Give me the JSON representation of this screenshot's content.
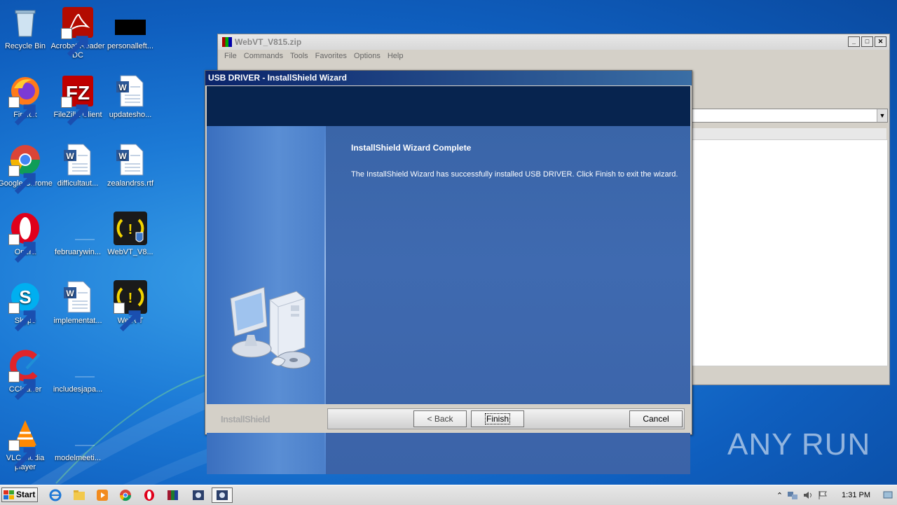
{
  "desktop": {
    "icons": [
      {
        "label": "Recycle Bin"
      },
      {
        "label": "Acrobat Reader DC"
      },
      {
        "label": "personalleft..."
      },
      {
        "label": "Firefox"
      },
      {
        "label": "FileZilla Client"
      },
      {
        "label": "updatesho..."
      },
      {
        "label": "Google Chrome"
      },
      {
        "label": "difficultaut..."
      },
      {
        "label": "zealandrss.rtf"
      },
      {
        "label": "Opera"
      },
      {
        "label": "februarywin..."
      },
      {
        "label": "WebVT_V8..."
      },
      {
        "label": "Skype"
      },
      {
        "label": "implementat..."
      },
      {
        "label": "WebVT"
      },
      {
        "label": "CCleaner"
      },
      {
        "label": "includesjapa..."
      },
      {
        "label": "VLC media player"
      },
      {
        "label": "modelmeeti..."
      }
    ]
  },
  "winrar": {
    "title": "WebVT_V815.zip",
    "menu": [
      "File",
      "Commands",
      "Tools",
      "Favorites",
      "Options",
      "Help"
    ]
  },
  "dialog": {
    "title": "USB DRIVER - InstallShield Wizard",
    "heading": "InstallShield Wizard Complete",
    "message": "The InstallShield Wizard has successfully installed USB DRIVER.  Click Finish to exit the wizard.",
    "brand": "InstallShield",
    "buttons": {
      "back": "< Back",
      "finish": "Finish",
      "cancel": "Cancel"
    }
  },
  "taskbar": {
    "start_label": "Start",
    "clock": "1:31 PM"
  },
  "watermark": "ANY RUN"
}
